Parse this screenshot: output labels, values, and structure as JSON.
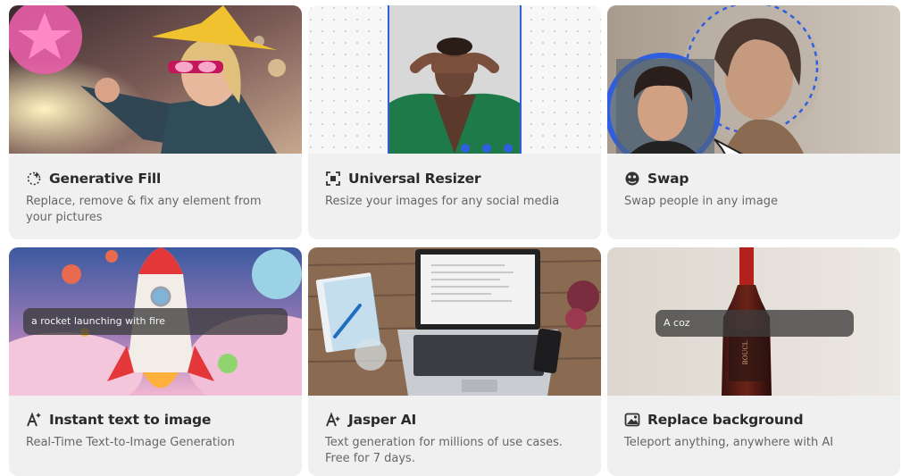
{
  "cards": [
    {
      "title": "Generative Fill",
      "description": "Replace, remove & fix any element from your pictures",
      "icon": "dotted-circle-sparkle-icon"
    },
    {
      "title": "Universal Resizer",
      "description": "Resize your images for any social media",
      "icon": "resize-frame-icon"
    },
    {
      "title": "Swap",
      "description": "Swap people in any image",
      "icon": "face-swap-icon"
    },
    {
      "title": "Instant text to image",
      "description": "Real-Time Text-to-Image Generation",
      "icon": "text-sparkle-icon",
      "prompt": "a rocket launching with fire"
    },
    {
      "title": "Jasper AI",
      "description": "Text generation for millions of use cases. Free for 7 days.",
      "icon": "a-sparkle-icon"
    },
    {
      "title": "Replace background",
      "description": "Teleport anything, anywhere with AI",
      "icon": "image-replace-icon",
      "prompt": "A coz"
    }
  ]
}
